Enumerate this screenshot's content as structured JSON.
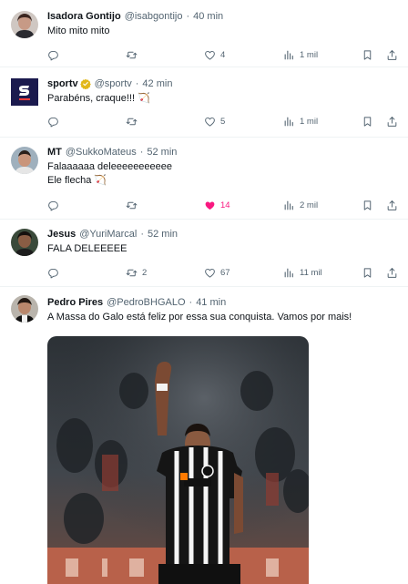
{
  "tweets": [
    {
      "display_name": "Isadora Gontijo",
      "handle": "@isabgontijo",
      "time": "40 min",
      "text": "Mito mito mito",
      "replies": "",
      "retweets": "",
      "likes": "4",
      "views": "1 mil",
      "liked": false
    },
    {
      "display_name": "sportv",
      "handle": "@sportv",
      "time": "42 min",
      "text": "Parabéns, craque!!! 🏹",
      "replies": "",
      "retweets": "",
      "likes": "5",
      "views": "1 mil",
      "liked": false,
      "verified": true
    },
    {
      "display_name": "MT",
      "handle": "@SukkoMateus",
      "time": "52 min",
      "text": "Falaaaaaa deleeeeeeeeeee",
      "text2": "Ele flecha 🏹",
      "replies": "",
      "retweets": "",
      "likes": "14",
      "views": "2 mil",
      "liked": true
    },
    {
      "display_name": "Jesus",
      "handle": "@YuriMarcal",
      "time": "52 min",
      "text": "FALA DELEEEEE",
      "replies": "",
      "retweets": "2",
      "likes": "67",
      "views": "11 mil",
      "liked": false
    },
    {
      "display_name": "Pedro Pires",
      "handle": "@PedroBHGALO",
      "time": "41 min",
      "text": "A Massa do Galo está feliz por essa sua conquista. Vamos por mais!",
      "media": "photo"
    }
  ],
  "sep": "·",
  "colors": {
    "text": "#0f1419",
    "muted": "#536471",
    "like_active": "#f91880",
    "divider": "#eff3f4",
    "verified_gold": "#e2b719",
    "sportv_bg": "#1b1a4e"
  },
  "icons": [
    "reply-icon",
    "retweet-icon",
    "like-icon",
    "views-icon",
    "bookmark-icon",
    "share-icon"
  ]
}
